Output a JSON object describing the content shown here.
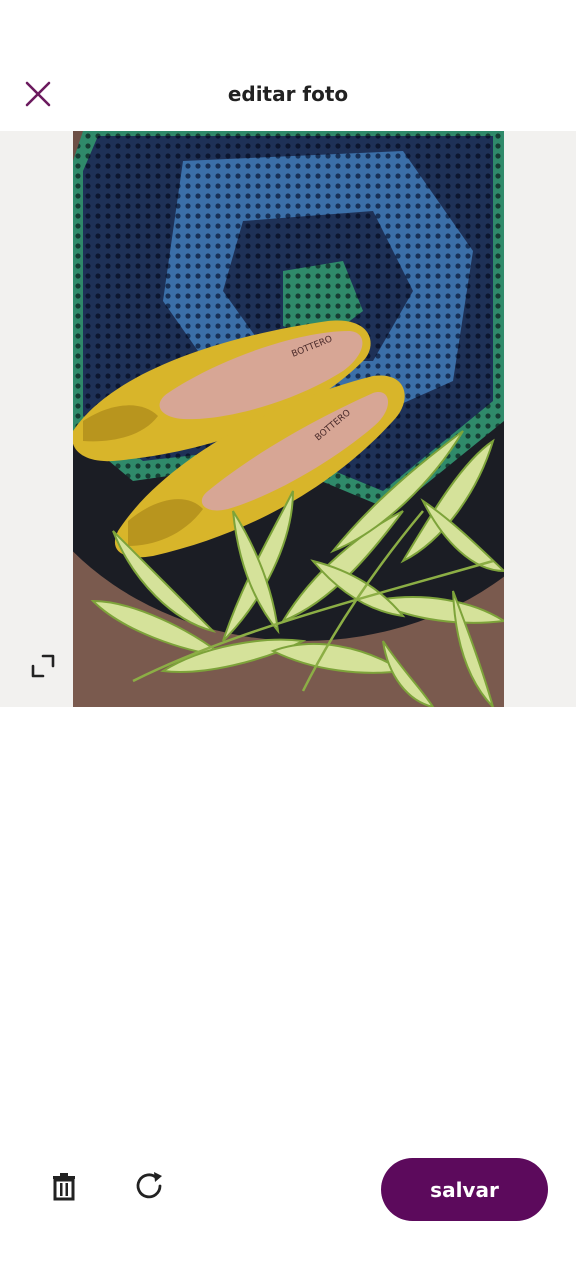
{
  "header": {
    "title": "editar foto",
    "close_icon": "close-icon"
  },
  "photo": {
    "brand_text": "BOTTERO",
    "expand_icon": "expand-icon"
  },
  "toolbar": {
    "delete_icon": "trash-icon",
    "rotate_icon": "rotate-icon",
    "save_label": "salvar"
  },
  "colors": {
    "accent": "#5c0a5c",
    "close_icon": "#6b1a5e",
    "background": "#ffffff",
    "photo_backdrop": "#f2f1ef"
  }
}
